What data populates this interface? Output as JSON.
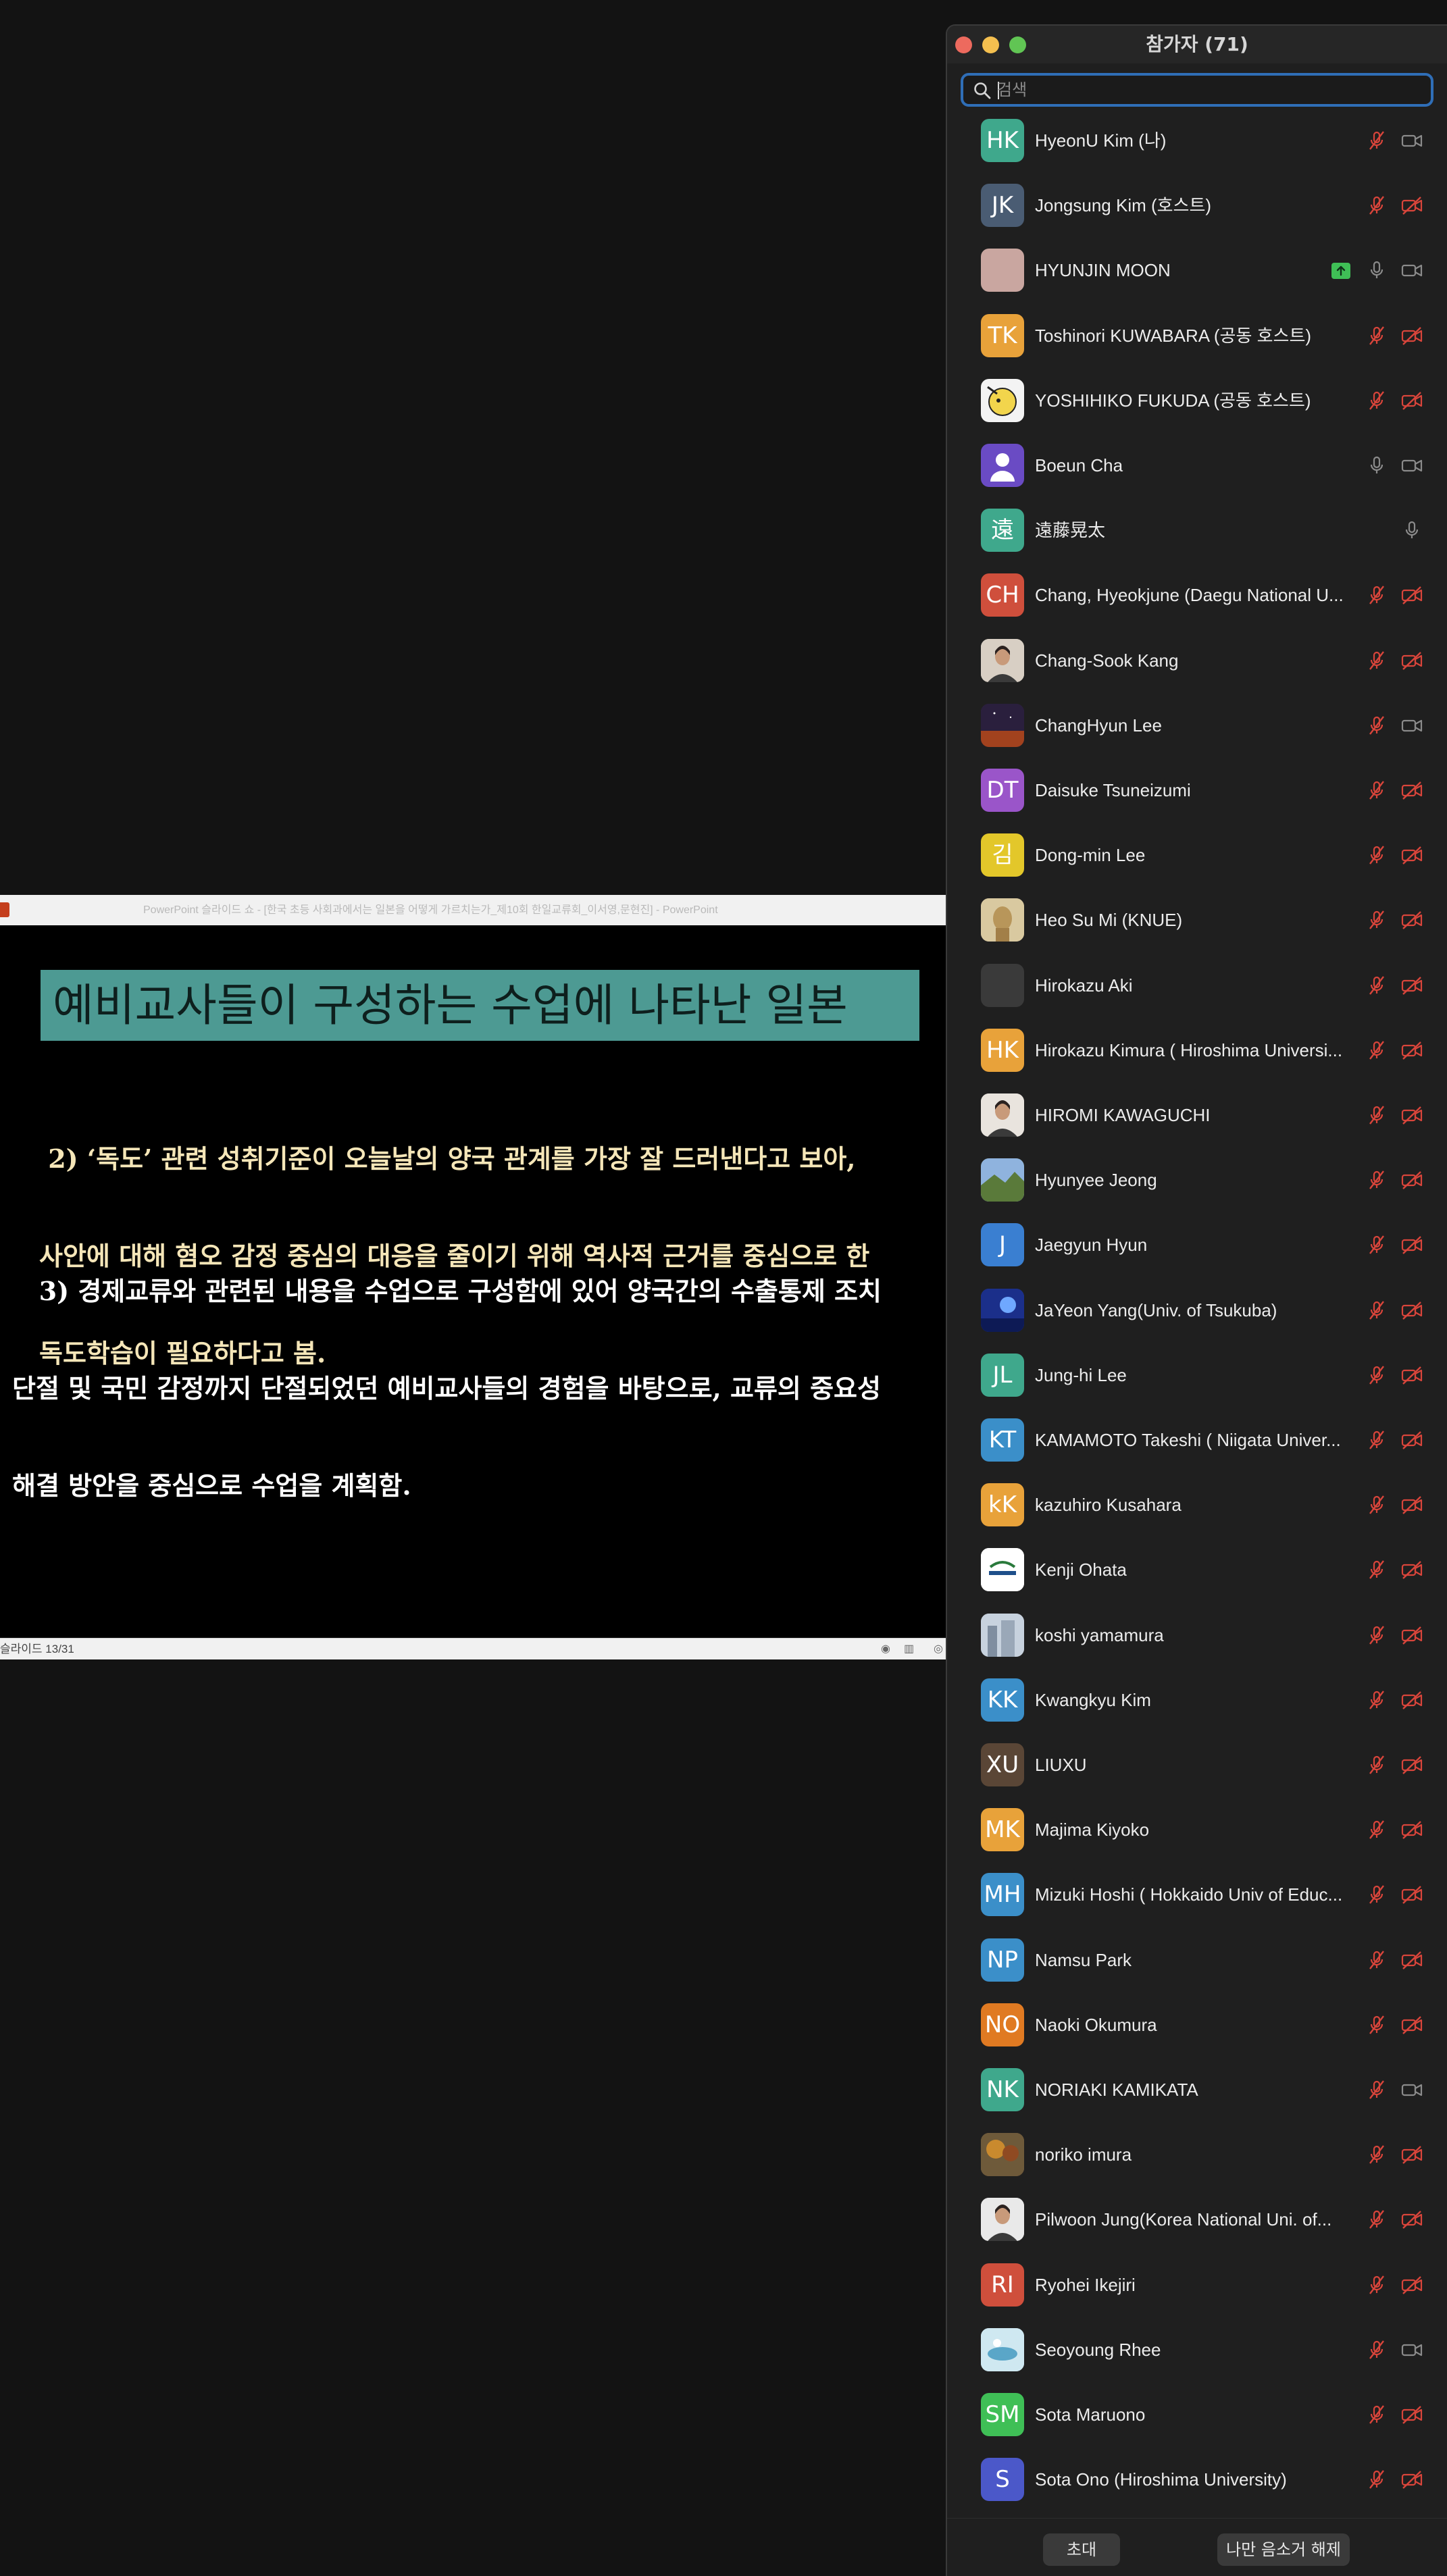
{
  "presentation": {
    "titlebar": "PowerPoint 슬라이드 쇼 - [한국 초등 사회과에서는 일본을 어떻게 가르치는가_제10회 한일교류회_이서영,문현진] - PowerPoint",
    "slide": {
      "heading": "예비교사들이 구성하는 수업에 나타난 일본",
      "para2_lines": [
        " 2) ‘독도’ 관련 성취기준이 오늘날의 양국 관계를 가장 잘 드러낸다고 보아,",
        "사안에 대해 혐오 감정 중심의 대응을 줄이기 위해 역사적 근거를 중심으로 한",
        "독도학습이 필요하다고 봄."
      ],
      "para3_lines": [
        "   3) 경제교류와 관련된 내용을 수업으로 구성함에 있어 양국간의 수출통제 조치",
        "단절 및 국민 감정까지 단절되었던 예비교사들의 경험을 바탕으로, 교류의 중요성",
        "해결 방안을 중심으로 수업을 계획함."
      ]
    },
    "statusbar": {
      "slide_counter": "슬라이드 13/31"
    }
  },
  "participants_panel": {
    "title": "참가자 (71)",
    "search": {
      "placeholder": "검색",
      "value": ""
    },
    "colors": {
      "mic_off": "#d9453b",
      "icon_neutral": "#8b8b8b",
      "share": "#3fbf56",
      "focus_ring": "#2f6eb7"
    },
    "participants": [
      {
        "name": "HyeonU Kim (나)",
        "initials": "HK",
        "color": "#3fa88c",
        "mic": "off",
        "video": "on"
      },
      {
        "name": "Jongsung Kim (호스트)",
        "initials": "JK",
        "color": "#4a5c73",
        "mic": "off",
        "video": "off"
      },
      {
        "name": "HYUNJIN MOON",
        "initials": "",
        "color": "#c9a6a0",
        "mic": "on",
        "video": "on",
        "sharing": true
      },
      {
        "name": "Toshinori KUWABARA (공동 호스트)",
        "initials": "TK",
        "color": "#e8a23a",
        "mic": "off",
        "video": "off"
      },
      {
        "name": "YOSHIHIKO FUKUDA (공동 호스트)",
        "initials": "",
        "color": "#f3f3f3",
        "picture": "cartoon-avatar",
        "mic": "off",
        "video": "off"
      },
      {
        "name": "Boeun Cha",
        "initials": "",
        "color": "#6a4bc4",
        "picture": "person-silhouette",
        "mic": "on",
        "video": "on"
      },
      {
        "name": "遠藤晃太",
        "initials": "遠",
        "color": "#3fa88c",
        "mic": "on",
        "video": "none"
      },
      {
        "name": "Chang, Hyeokjune (Daegu National U...",
        "initials": "CH",
        "color": "#cf4f3c",
        "mic": "off",
        "video": "off"
      },
      {
        "name": "Chang-Sook Kang",
        "initials": "",
        "color": "#d8cfc4",
        "picture": "portrait-photo",
        "mic": "off",
        "video": "off"
      },
      {
        "name": "ChangHyun Lee",
        "initials": "",
        "color": "#3b2a4a",
        "picture": "night-sky-photo",
        "mic": "off",
        "video": "on"
      },
      {
        "name": "Daisuke Tsuneizumi",
        "initials": "DT",
        "color": "#9a55c9",
        "mic": "off",
        "video": "off"
      },
      {
        "name": "Dong-min Lee",
        "initials": "김",
        "color": "#e3c72a",
        "mic": "off",
        "video": "off"
      },
      {
        "name": "Heo Su Mi (KNUE)",
        "initials": "",
        "color": "#c7b48a",
        "picture": "statue-photo",
        "mic": "off",
        "video": "off"
      },
      {
        "name": "Hirokazu Aki",
        "initials": "",
        "color": "#3a3a3a",
        "mic": "off",
        "video": "off"
      },
      {
        "name": "Hirokazu Kimura ( Hiroshima Universi...",
        "initials": "HK",
        "color": "#e8a23a",
        "mic": "off",
        "video": "off"
      },
      {
        "name": "HIROMI KAWAGUCHI",
        "initials": "",
        "color": "#e9e4de",
        "picture": "portrait-photo",
        "mic": "off",
        "video": "off"
      },
      {
        "name": "Hyunyee Jeong",
        "initials": "",
        "color": "#6f8a4e",
        "picture": "landscape-photo",
        "mic": "off",
        "video": "off"
      },
      {
        "name": "Jaegyun Hyun",
        "initials": "J",
        "color": "#3a7fd1",
        "mic": "off",
        "video": "off"
      },
      {
        "name": "JaYeon Yang(Univ. of Tsukuba)",
        "initials": "",
        "color": "#2640a8",
        "picture": "blue-abstract-photo",
        "mic": "off",
        "video": "off"
      },
      {
        "name": "Jung-hi Lee",
        "initials": "JL",
        "color": "#3fa88c",
        "mic": "off",
        "video": "off"
      },
      {
        "name": "KAMAMOTO Takeshi ( Niigata Univer...",
        "initials": "KT",
        "color": "#3b8fc9",
        "mic": "off",
        "video": "off"
      },
      {
        "name": "kazuhiro Kusahara",
        "initials": "kK",
        "color": "#e8a23a",
        "mic": "off",
        "video": "off"
      },
      {
        "name": "Kenji Ohata",
        "initials": "",
        "color": "#ffffff",
        "picture": "logo-image",
        "mic": "off",
        "video": "off"
      },
      {
        "name": "koshi yamamura",
        "initials": "",
        "color": "#b9c3cf",
        "picture": "building-photo",
        "mic": "off",
        "video": "off"
      },
      {
        "name": "Kwangkyu Kim",
        "initials": "KK",
        "color": "#3b8fc9",
        "mic": "off",
        "video": "off"
      },
      {
        "name": "LIUXU",
        "initials": "XU",
        "color": "#5a4636",
        "mic": "off",
        "video": "off"
      },
      {
        "name": "Majima Kiyoko",
        "initials": "MK",
        "color": "#e8a23a",
        "mic": "off",
        "video": "off"
      },
      {
        "name": "Mizuki Hoshi ( Hokkaido Univ of Educ...",
        "initials": "MH",
        "color": "#3b8fc9",
        "mic": "off",
        "video": "off"
      },
      {
        "name": "Namsu Park",
        "initials": "NP",
        "color": "#3b8fc9",
        "mic": "off",
        "video": "off"
      },
      {
        "name": "Naoki Okumura",
        "initials": "NO",
        "color": "#e07a22",
        "mic": "off",
        "video": "off"
      },
      {
        "name": "NORIAKI KAMIKATA",
        "initials": "NK",
        "color": "#3fa88c",
        "mic": "off",
        "video": "on"
      },
      {
        "name": "noriko imura",
        "initials": "",
        "color": "#8a6b3e",
        "picture": "autumn-photo",
        "mic": "off",
        "video": "off"
      },
      {
        "name": "Pilwoon Jung(Korea National Uni. of...",
        "initials": "",
        "color": "#e9e9e9",
        "picture": "portrait-photo",
        "mic": "off",
        "video": "off"
      },
      {
        "name": "Ryohei Ikejiri",
        "initials": "RI",
        "color": "#cf4f3c",
        "mic": "off",
        "video": "off"
      },
      {
        "name": "Seoyoung Rhee",
        "initials": "",
        "color": "#bfe1ec",
        "picture": "illustration",
        "mic": "off",
        "video": "on"
      },
      {
        "name": "Sota Maruono",
        "initials": "SM",
        "color": "#3fbf56",
        "mic": "off",
        "video": "off"
      },
      {
        "name": "Sota Ono (Hiroshima University)",
        "initials": "S",
        "color": "#4b58c9",
        "mic": "off",
        "video": "off"
      }
    ],
    "footer": {
      "invite_label": "초대",
      "unmute_me_label": "나만 음소거 해제"
    }
  }
}
